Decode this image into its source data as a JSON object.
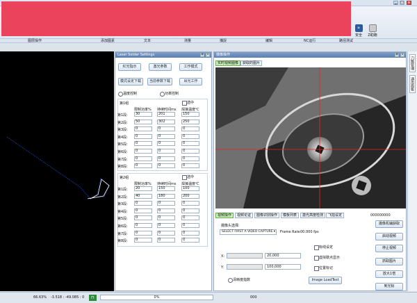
{
  "ribbon": {
    "groups": [
      "图层操作",
      "添加图素",
      "文本",
      "测量",
      "捕捉",
      "编辑",
      "NC运行",
      "路径测试"
    ],
    "tools": [
      {
        "label": "安全",
        "icon": "shield-icon"
      },
      {
        "label": "Z助跑",
        "icon": "lock-icon"
      }
    ]
  },
  "laser": {
    "title": "Laser Solder Settings",
    "buttons": [
      "红光指示",
      "激光参数",
      "工作模式",
      "模式设定下载",
      "当前参数下载",
      "出光工作"
    ],
    "modes": [
      "温度控制",
      "功率控制"
    ],
    "headers": [
      "限制功率%",
      "持续时间ms",
      "焊接温度℃"
    ],
    "group1": {
      "label": "第1组",
      "select_label": "选中",
      "rows": [
        {
          "label": "第1段:",
          "v": [
            "30",
            "201",
            "150"
          ]
        },
        {
          "label": "第2段:",
          "v": [
            "50",
            "302",
            "250"
          ]
        },
        {
          "label": "第3段:",
          "v": [
            "0",
            "0",
            "0"
          ]
        },
        {
          "label": "第4段:",
          "v": [
            "0",
            "0",
            "0"
          ]
        },
        {
          "label": "第5段:",
          "v": [
            "0",
            "0",
            "0"
          ]
        },
        {
          "label": "第6段:",
          "v": [
            "0",
            "0",
            "0"
          ]
        },
        {
          "label": "第7段:",
          "v": [
            "0",
            "0",
            "0"
          ]
        },
        {
          "label": "第8段:",
          "v": [
            "0",
            "0",
            "0"
          ]
        }
      ]
    },
    "group2": {
      "label": "第2组",
      "select_label": "选中",
      "rows": [
        {
          "label": "第1段:",
          "v": [
            "20",
            "150",
            "100"
          ]
        },
        {
          "label": "第2段:",
          "v": [
            "40",
            "180",
            "200"
          ]
        },
        {
          "label": "第3段:",
          "v": [
            "0",
            "0",
            "0"
          ]
        },
        {
          "label": "第4段:",
          "v": [
            "0",
            "0",
            "0"
          ]
        },
        {
          "label": "第5段:",
          "v": [
            "0",
            "0",
            "0"
          ]
        },
        {
          "label": "第6段:",
          "v": [
            "0",
            "0",
            "0"
          ]
        },
        {
          "label": "第7段:",
          "v": [
            "0",
            "0",
            "0"
          ]
        },
        {
          "label": "第8段:",
          "v": [
            "0",
            "0",
            "0"
          ]
        }
      ]
    }
  },
  "camera": {
    "title": "摄像操作",
    "view_tabs": [
      "实时视频图像",
      "获取的图片"
    ],
    "bottom_tabs": [
      "视频操作",
      "视频论证",
      "图像识别操作",
      "模板列表",
      "激光高度检测",
      "飞拍设定"
    ],
    "counter": "000000000",
    "camera_select_label": "摄像头选择:",
    "camera_select_value": "SELECT FIRST A VIDEO CAPTURE",
    "frame_rate_label": "Frame Rate",
    "frame_rate_value": "00.000 fps",
    "x_label": "X:",
    "x_value": "20,000",
    "y_label": "Y:",
    "y_value": "100,000",
    "check_marker": "标线设定",
    "check_virtual": "虚拟歇点显示",
    "check_position": "位置标记",
    "check_clarity": "清晰度指数",
    "loadtest_label": "Image LoadTest",
    "side_buttons": [
      "摄像机辅获取",
      "启动视频",
      "停止视频",
      "抓取图片",
      "放大1倍",
      "到光标"
    ]
  },
  "rightstrip": {
    "tabs": [
      "刀路管理",
      "通用面板"
    ]
  },
  "status": {
    "zoom": "66.63%",
    "coords": "-3.518 : -49.085 : 0",
    "progress": "0%",
    "code": "000"
  }
}
